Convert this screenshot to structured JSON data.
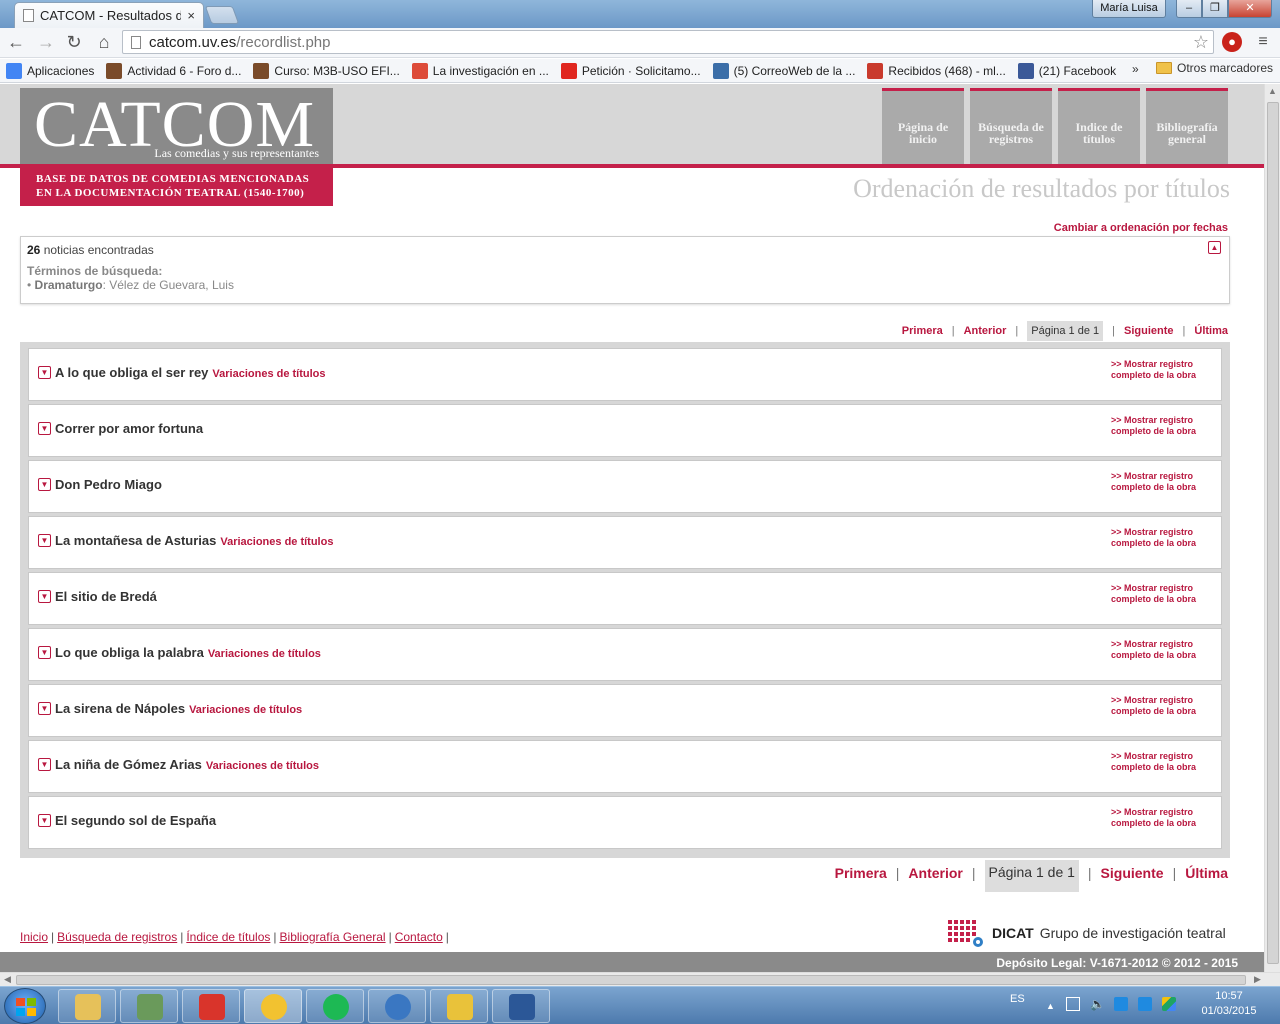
{
  "browser": {
    "tab_title": "CATCOM - Resultados de",
    "tab_close": "×",
    "user_name": "María Luisa",
    "url_host": "catcom.uv.es",
    "url_path": "/recordlist.php",
    "bookmarks": [
      {
        "label": "Aplicaciones",
        "icon": "apps-grid-icon",
        "color": "#4285f4"
      },
      {
        "label": "Actividad 6 - Foro d...",
        "icon": "uni-crest-icon",
        "color": "#7a4b2a"
      },
      {
        "label": "Curso: M3B-USO EFI...",
        "icon": "uni-crest-icon",
        "color": "#7a4b2a"
      },
      {
        "label": "La investigación en ...",
        "icon": "google-plus-icon",
        "color": "#dd4b39"
      },
      {
        "label": "Petición · Solicitamo...",
        "icon": "change-org-icon",
        "color": "#e0261f"
      },
      {
        "label": "(5) CorreoWeb de la ...",
        "icon": "mail-web-icon",
        "color": "#3b6ea8"
      },
      {
        "label": "Recibidos (468) - ml...",
        "icon": "gmail-icon",
        "color": "#c93a2d"
      },
      {
        "label": "(21) Facebook",
        "icon": "facebook-icon",
        "color": "#3b5998"
      }
    ],
    "bookmarks_more": "»",
    "other_bookmarks": "Otros marcadores"
  },
  "site": {
    "logo_title": "CATCOM",
    "logo_subtitle": "Las comedias y sus representantes",
    "logo_tagline_1": "BASE DE DATOS DE COMEDIAS MENCIONADAS",
    "logo_tagline_2": "EN LA DOCUMENTACIÓN TEATRAL (1540-1700)",
    "nav": [
      {
        "line1": "Página de",
        "line2": "inicio"
      },
      {
        "line1": "Búsqueda de",
        "line2": "registros"
      },
      {
        "line1": "Indice de",
        "line2": "títulos"
      },
      {
        "line1": "Bibliografía",
        "line2": "general"
      }
    ],
    "page_title": "Ordenación de resultados por títulos",
    "change_order": "Cambiar a ordenación por fechas",
    "brand_color": "#c4204a"
  },
  "search_info": {
    "count": "26",
    "count_label": " noticias encontradas",
    "terms_label": "Términos de búsqueda:",
    "term_field": "Dramaturgo",
    "term_value": ": Vélez de Guevara, Luis"
  },
  "pager": {
    "first": "Primera",
    "prev": "Anterior",
    "current": "Página 1 de 1",
    "next": "Siguiente",
    "last": "Última",
    "separator": "|"
  },
  "results": [
    {
      "title": "A lo que obliga el ser rey",
      "variants": "Variaciones de títulos"
    },
    {
      "title": "Correr por amor fortuna",
      "variants": ""
    },
    {
      "title": "Don Pedro Miago",
      "variants": ""
    },
    {
      "title": "La montañesa de Asturias",
      "variants": "Variaciones de títulos"
    },
    {
      "title": "El sitio de Bredá",
      "variants": ""
    },
    {
      "title": "Lo que obliga la palabra",
      "variants": "Variaciones de títulos"
    },
    {
      "title": "La sirena de Nápoles",
      "variants": "Variaciones de títulos"
    },
    {
      "title": "La niña de Gómez Arias",
      "variants": "Variaciones de títulos"
    },
    {
      "title": "El segundo sol de España",
      "variants": ""
    }
  ],
  "result_link_1": ">> Mostrar registro",
  "result_link_2": "completo de la obra",
  "footer": {
    "links": [
      "Inicio",
      "Búsqueda de registros",
      "Índice de títulos",
      "Bibliografía General",
      "Contacto"
    ],
    "dicat_name": "DICAT",
    "dicat_sub": "Grupo de investigación teatral",
    "legal": "Depósito Legal: V-1671-2012  © 2012 - 2015"
  },
  "taskbar": {
    "apps": [
      {
        "icon": "file-explorer-icon",
        "color": "#e6c15a"
      },
      {
        "icon": "photo-viewer-icon",
        "color": "#6a9a5b"
      },
      {
        "icon": "pdf-reader-icon",
        "color": "#d9342b"
      },
      {
        "icon": "chrome-icon",
        "color": "#f2c230"
      },
      {
        "icon": "spotify-icon",
        "color": "#1db954"
      },
      {
        "icon": "network-globe-icon",
        "color": "#3a77c2"
      },
      {
        "icon": "security-shield-icon",
        "color": "#e9c23a"
      },
      {
        "icon": "word-icon",
        "color": "#2b5797"
      }
    ],
    "lang": "ES",
    "time": "10:57",
    "date": "01/03/2015"
  }
}
